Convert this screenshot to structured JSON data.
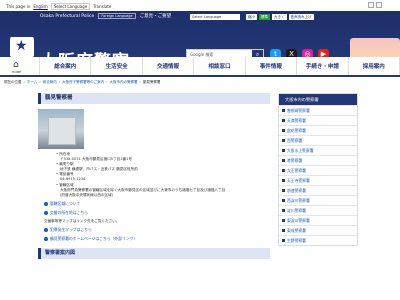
{
  "topbar": {
    "language_label": "This page in",
    "language_link": "English",
    "language_select": "Select Language",
    "translate_label": "Translate"
  },
  "header": {
    "org_name_en": "Osaka Prefectural Police",
    "foreign_language": "Foreign Language",
    "easy_japanese": "ご意見・ご要望",
    "select_language": "Select Language",
    "font_buttons": [
      "縮小",
      "標準",
      "大きく"
    ],
    "usage_link": "音声読み上げ",
    "site_title": "大阪府警察",
    "search_placeholder": "Google 検索"
  },
  "nav": {
    "home_label": "HOME",
    "items": [
      "総合案内",
      "生活安全",
      "交通情報",
      "相談窓口",
      "事件情報",
      "手続き・申請",
      "採用案内"
    ]
  },
  "breadcrumb": {
    "items": [
      "現在の位置",
      "ホーム",
      "総合案内",
      "大阪府下警察署等のご案内",
      "大阪市内の警察署",
      "鶴見警察署"
    ]
  },
  "main": {
    "heading": "鶴見警察署",
    "address_label": "所在地",
    "address_value": "〒538-0051 大阪市鶴見区諸口5丁目1番1号",
    "access_label": "最寄り駅",
    "access_value": "地下鉄 横堤駅、市バス・近鉄バス 鶴見区役所前",
    "tel_label": "電話番号",
    "tel_value": "06-6915-1234",
    "jurisdiction_label": "管轄区域",
    "jurisdiction_value_1": "大阪府門真警察署の管轄区域を除く大阪市鶴見区の区域並びに大東市のうち諸福七丁目及び諸福八丁目",
    "jurisdiction_value_2": "(府道大阪中央環状線以西の区域)",
    "link1": "管轄区域について",
    "link2": "交番の所在地はこちら",
    "note": "交番事故等マップはリンク先をご覧ください。",
    "link3": "犯罪発生マップはこちら",
    "link4": "鶴見警察署のホームページはこちら（外部リンク）",
    "section2": "警察署案内図"
  },
  "sidebar": {
    "heading": "大阪市内の警察署",
    "items": [
      "曽根崎警察署",
      "天満警察署",
      "此花警察署",
      "西警察署",
      "大阪水上警察署",
      "港警察署",
      "大正警察署",
      "天王寺警察署",
      "浪速警察署",
      "西淀川警察署",
      "淀川警察署",
      "東淀川警察署",
      "東成警察署",
      "生野警察署"
    ]
  },
  "colors": {
    "brand": "#233775",
    "link": "#1a5bb8",
    "heading_bg": "#dde4f3"
  }
}
